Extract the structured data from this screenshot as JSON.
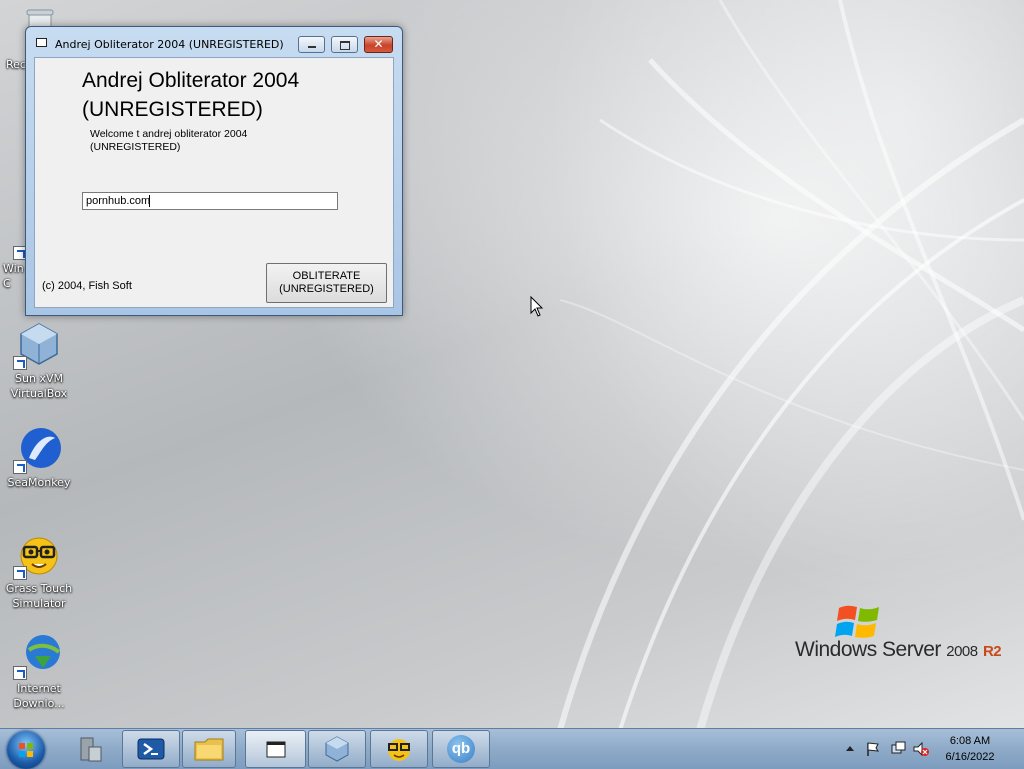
{
  "desktop": {
    "icons": [
      {
        "label": "Rec",
        "name": "recycle-bin"
      },
      {
        "label": "Win\nC",
        "name": "windows-c"
      },
      {
        "label": "Sun xVM\nVirtualBox",
        "name": "virtualbox"
      },
      {
        "label": "SeaMonkey",
        "name": "seamonkey"
      },
      {
        "label": "Grass Touch\nSimulator",
        "name": "grass-touch-simulator"
      },
      {
        "label": "Internet\nDownlo...",
        "name": "internet-download"
      }
    ]
  },
  "dialog": {
    "title": "Andrej Obliterator 2004 (UNREGISTERED)",
    "heading_line1": "Andrej Obliterator 2004",
    "heading_line2": "(UNREGISTERED)",
    "welcome_line1": "Welcome t andrej obliterator 2004",
    "welcome_line2": "(UNREGISTERED)",
    "url_value": "pornhub.com",
    "copyright": "(c) 2004, Fish Soft",
    "button_line1": "OBLITERATE",
    "button_line2": "(UNREGISTERED)"
  },
  "branding": {
    "windows": "Windows Server",
    "version": "2008",
    "edition": "R2"
  },
  "taskbar": {
    "items": [
      "server-manager",
      "powershell",
      "explorer",
      "dialog-window",
      "virtualbox",
      "grass-touch",
      "qbittorrent"
    ],
    "qb_label": "qb",
    "clock_time": "6:08 AM",
    "clock_date": "6/16/2022"
  },
  "colors": {
    "taskbar": "#8eaac8",
    "close_button": "#c8432a",
    "r2_accent": "#c84a1a"
  }
}
